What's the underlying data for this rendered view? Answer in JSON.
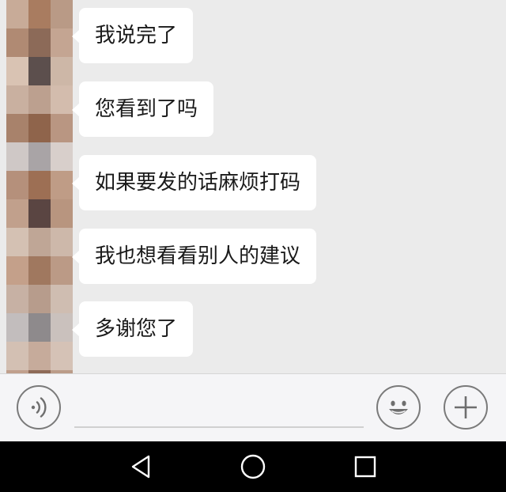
{
  "chat": {
    "messages": [
      {
        "text": "我说完了"
      },
      {
        "text": "您看到了吗"
      },
      {
        "text": "如果要发的话麻烦打码"
      },
      {
        "text": "我也想看看别人的建议"
      },
      {
        "text": "多谢您了"
      }
    ],
    "avatar_pixel_colors": [
      "#c8ab98",
      "#a97c60",
      "#b99a86",
      "#b08a73",
      "#8c6a58",
      "#c4a592",
      "#d9c3b3",
      "#5c4f4d",
      "#cdb7a7",
      "#c9b0a0",
      "#bca08f",
      "#d3bcad",
      "#a8826b",
      "#8f644b",
      "#b99682",
      "#cfc8c6",
      "#a9a4a6",
      "#d8cfcb",
      "#b5907b",
      "#9d6f54",
      "#bf9c86",
      "#c1a08c",
      "#5a4542",
      "#b8957f",
      "#d4c1b3",
      "#bfa696",
      "#cdb8aa",
      "#c4a08a",
      "#a0785f",
      "#bb9a86",
      "#c7b1a4",
      "#b79c8c",
      "#cfbdb1",
      "#c2bdbd",
      "#8e8a8c",
      "#cac1bd",
      "#d3c0b3",
      "#c6ab9b",
      "#d5c2b6",
      "#c0a08d",
      "#8e6b58",
      "#bb9c89",
      "#d2c7c2",
      "#b9b2b1",
      "#dcd3ce"
    ]
  },
  "input_bar": {
    "voice_icon": "voice-wave-icon",
    "text_value": "",
    "emoji_icon": "smiley-icon",
    "plus_icon": "plus-icon"
  },
  "nav_bar": {
    "back_icon": "triangle-back-icon",
    "home_icon": "circle-home-icon",
    "recents_icon": "square-recents-icon"
  },
  "colors": {
    "chat_background": "#ebebeb",
    "bubble_background": "#ffffff",
    "input_bar_background": "#f5f5f7",
    "nav_bar_background": "#000000"
  }
}
